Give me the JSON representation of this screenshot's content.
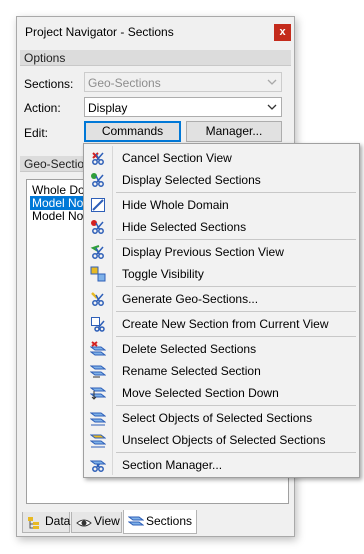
{
  "window": {
    "title": "Project Navigator - Sections",
    "close_glyph": "x"
  },
  "options": {
    "header": "Options",
    "sections_label": "Sections:",
    "sections_value": "Geo-Sections",
    "action_label": "Action:",
    "action_value": "Display",
    "edit_label": "Edit:",
    "commands_button": "Commands",
    "manager_button": "Manager..."
  },
  "geo_sections": {
    "header": "Geo-Section",
    "items": [
      {
        "label": "Whole Dom",
        "selected": false
      },
      {
        "label": "Model No.",
        "selected": true
      },
      {
        "label": "Model No.",
        "selected": false
      }
    ]
  },
  "tabs": [
    {
      "label": "Data",
      "icon": "data-tree-icon",
      "active": false
    },
    {
      "label": "View",
      "icon": "eye-icon",
      "active": false
    },
    {
      "label": "Sections",
      "icon": "sections-icon",
      "active": true
    }
  ],
  "menu": {
    "items": [
      {
        "label": "Cancel Section View",
        "icon": "cancel-section-view-icon"
      },
      {
        "label": "Display Selected Sections",
        "icon": "display-selected-sections-icon"
      },
      {
        "label": "Hide Whole Domain",
        "icon": "hide-whole-domain-icon"
      },
      {
        "label": "Hide Selected Sections",
        "icon": "hide-selected-sections-icon"
      },
      {
        "label": "Display Previous Section View",
        "icon": "display-previous-section-view-icon"
      },
      {
        "label": "Toggle Visibility",
        "icon": "toggle-visibility-icon"
      },
      {
        "label": "Generate Geo-Sections...",
        "icon": "generate-geo-sections-icon"
      },
      {
        "label": "Create New Section from Current View",
        "icon": "create-new-section-icon"
      },
      {
        "label": "Delete Selected Sections",
        "icon": "delete-selected-sections-icon"
      },
      {
        "label": "Rename Selected Section",
        "icon": "rename-selected-section-icon"
      },
      {
        "label": "Move Selected Section Down",
        "icon": "move-section-down-icon"
      },
      {
        "label": "Select Objects of Selected Sections",
        "icon": "select-objects-icon"
      },
      {
        "label": "Unselect Objects of Selected Sections",
        "icon": "unselect-objects-icon"
      },
      {
        "label": "Section Manager...",
        "icon": "section-manager-icon"
      }
    ]
  },
  "colors": {
    "accent_blue": "#0078d7",
    "close_red": "#c42b1c",
    "icon_blue": "#2e5fb8",
    "icon_red": "#d42121",
    "icon_green": "#2f9e3a",
    "icon_yellow": "#e8b923"
  }
}
